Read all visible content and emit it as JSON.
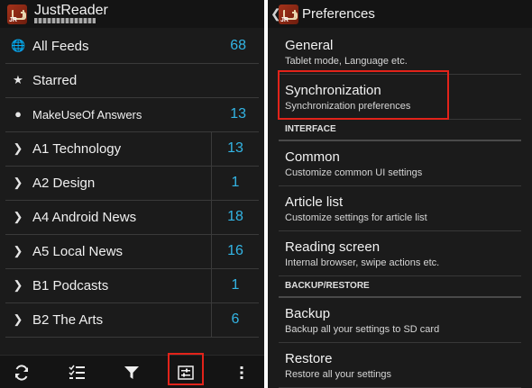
{
  "left": {
    "app_title": "JustReader",
    "feeds": [
      {
        "icon": "globe-icon",
        "glyph": "🌐",
        "label": "All Feeds",
        "count": "68",
        "type": "plain"
      },
      {
        "icon": "star-icon",
        "glyph": "★",
        "label": "Starred",
        "count": "",
        "type": "plain"
      },
      {
        "icon": "dot-icon",
        "glyph": "●",
        "label": "MakeUseOf Answers",
        "count": "13",
        "type": "plain",
        "small": true
      },
      {
        "icon": "chevron-right-icon",
        "glyph": "❯",
        "label": "A1 Technology",
        "count": "13",
        "type": "folder"
      },
      {
        "icon": "chevron-right-icon",
        "glyph": "❯",
        "label": "A2 Design",
        "count": "1",
        "type": "folder"
      },
      {
        "icon": "chevron-right-icon",
        "glyph": "❯",
        "label": "A4 Android News",
        "count": "18",
        "type": "folder"
      },
      {
        "icon": "chevron-right-icon",
        "glyph": "❯",
        "label": "A5 Local News",
        "count": "16",
        "type": "folder"
      },
      {
        "icon": "chevron-right-icon",
        "glyph": "❯",
        "label": "B1 Podcasts",
        "count": "1",
        "type": "folder"
      },
      {
        "icon": "chevron-right-icon",
        "glyph": "❯",
        "label": "B2 The Arts",
        "count": "6",
        "type": "folder"
      }
    ],
    "bottom_bar": [
      {
        "name": "refresh-button",
        "icon": "refresh-icon"
      },
      {
        "name": "mark-read-button",
        "icon": "checklist-icon"
      },
      {
        "name": "filter-button",
        "icon": "filter-icon"
      },
      {
        "name": "settings-button",
        "icon": "settings-sliders-icon"
      },
      {
        "name": "overflow-menu-button",
        "icon": "more-vertical-icon"
      }
    ]
  },
  "right": {
    "title": "Preferences",
    "items": [
      {
        "kind": "item",
        "name": "pref-general",
        "title": "General",
        "summary": "Tablet mode, Language etc."
      },
      {
        "kind": "item",
        "name": "pref-synchronization",
        "title": "Synchronization",
        "summary": "Synchronization preferences"
      },
      {
        "kind": "category",
        "name": "category-interface",
        "title": "INTERFACE"
      },
      {
        "kind": "item",
        "name": "pref-common",
        "title": "Common",
        "summary": "Customize common UI settings"
      },
      {
        "kind": "item",
        "name": "pref-article-list",
        "title": "Article list",
        "summary": "Customize settings for article list"
      },
      {
        "kind": "item",
        "name": "pref-reading-screen",
        "title": "Reading screen",
        "summary": "Internal browser, swipe actions etc."
      },
      {
        "kind": "category",
        "name": "category-backup-restore",
        "title": "BACKUP/RESTORE"
      },
      {
        "kind": "item",
        "name": "pref-backup",
        "title": "Backup",
        "summary": "Backup all your settings to SD card"
      },
      {
        "kind": "item",
        "name": "pref-restore",
        "title": "Restore",
        "summary": "Restore all your settings"
      }
    ]
  },
  "colors": {
    "accent": "#33b5e5",
    "highlight": "#e2231a",
    "background": "#1b1b1b"
  }
}
